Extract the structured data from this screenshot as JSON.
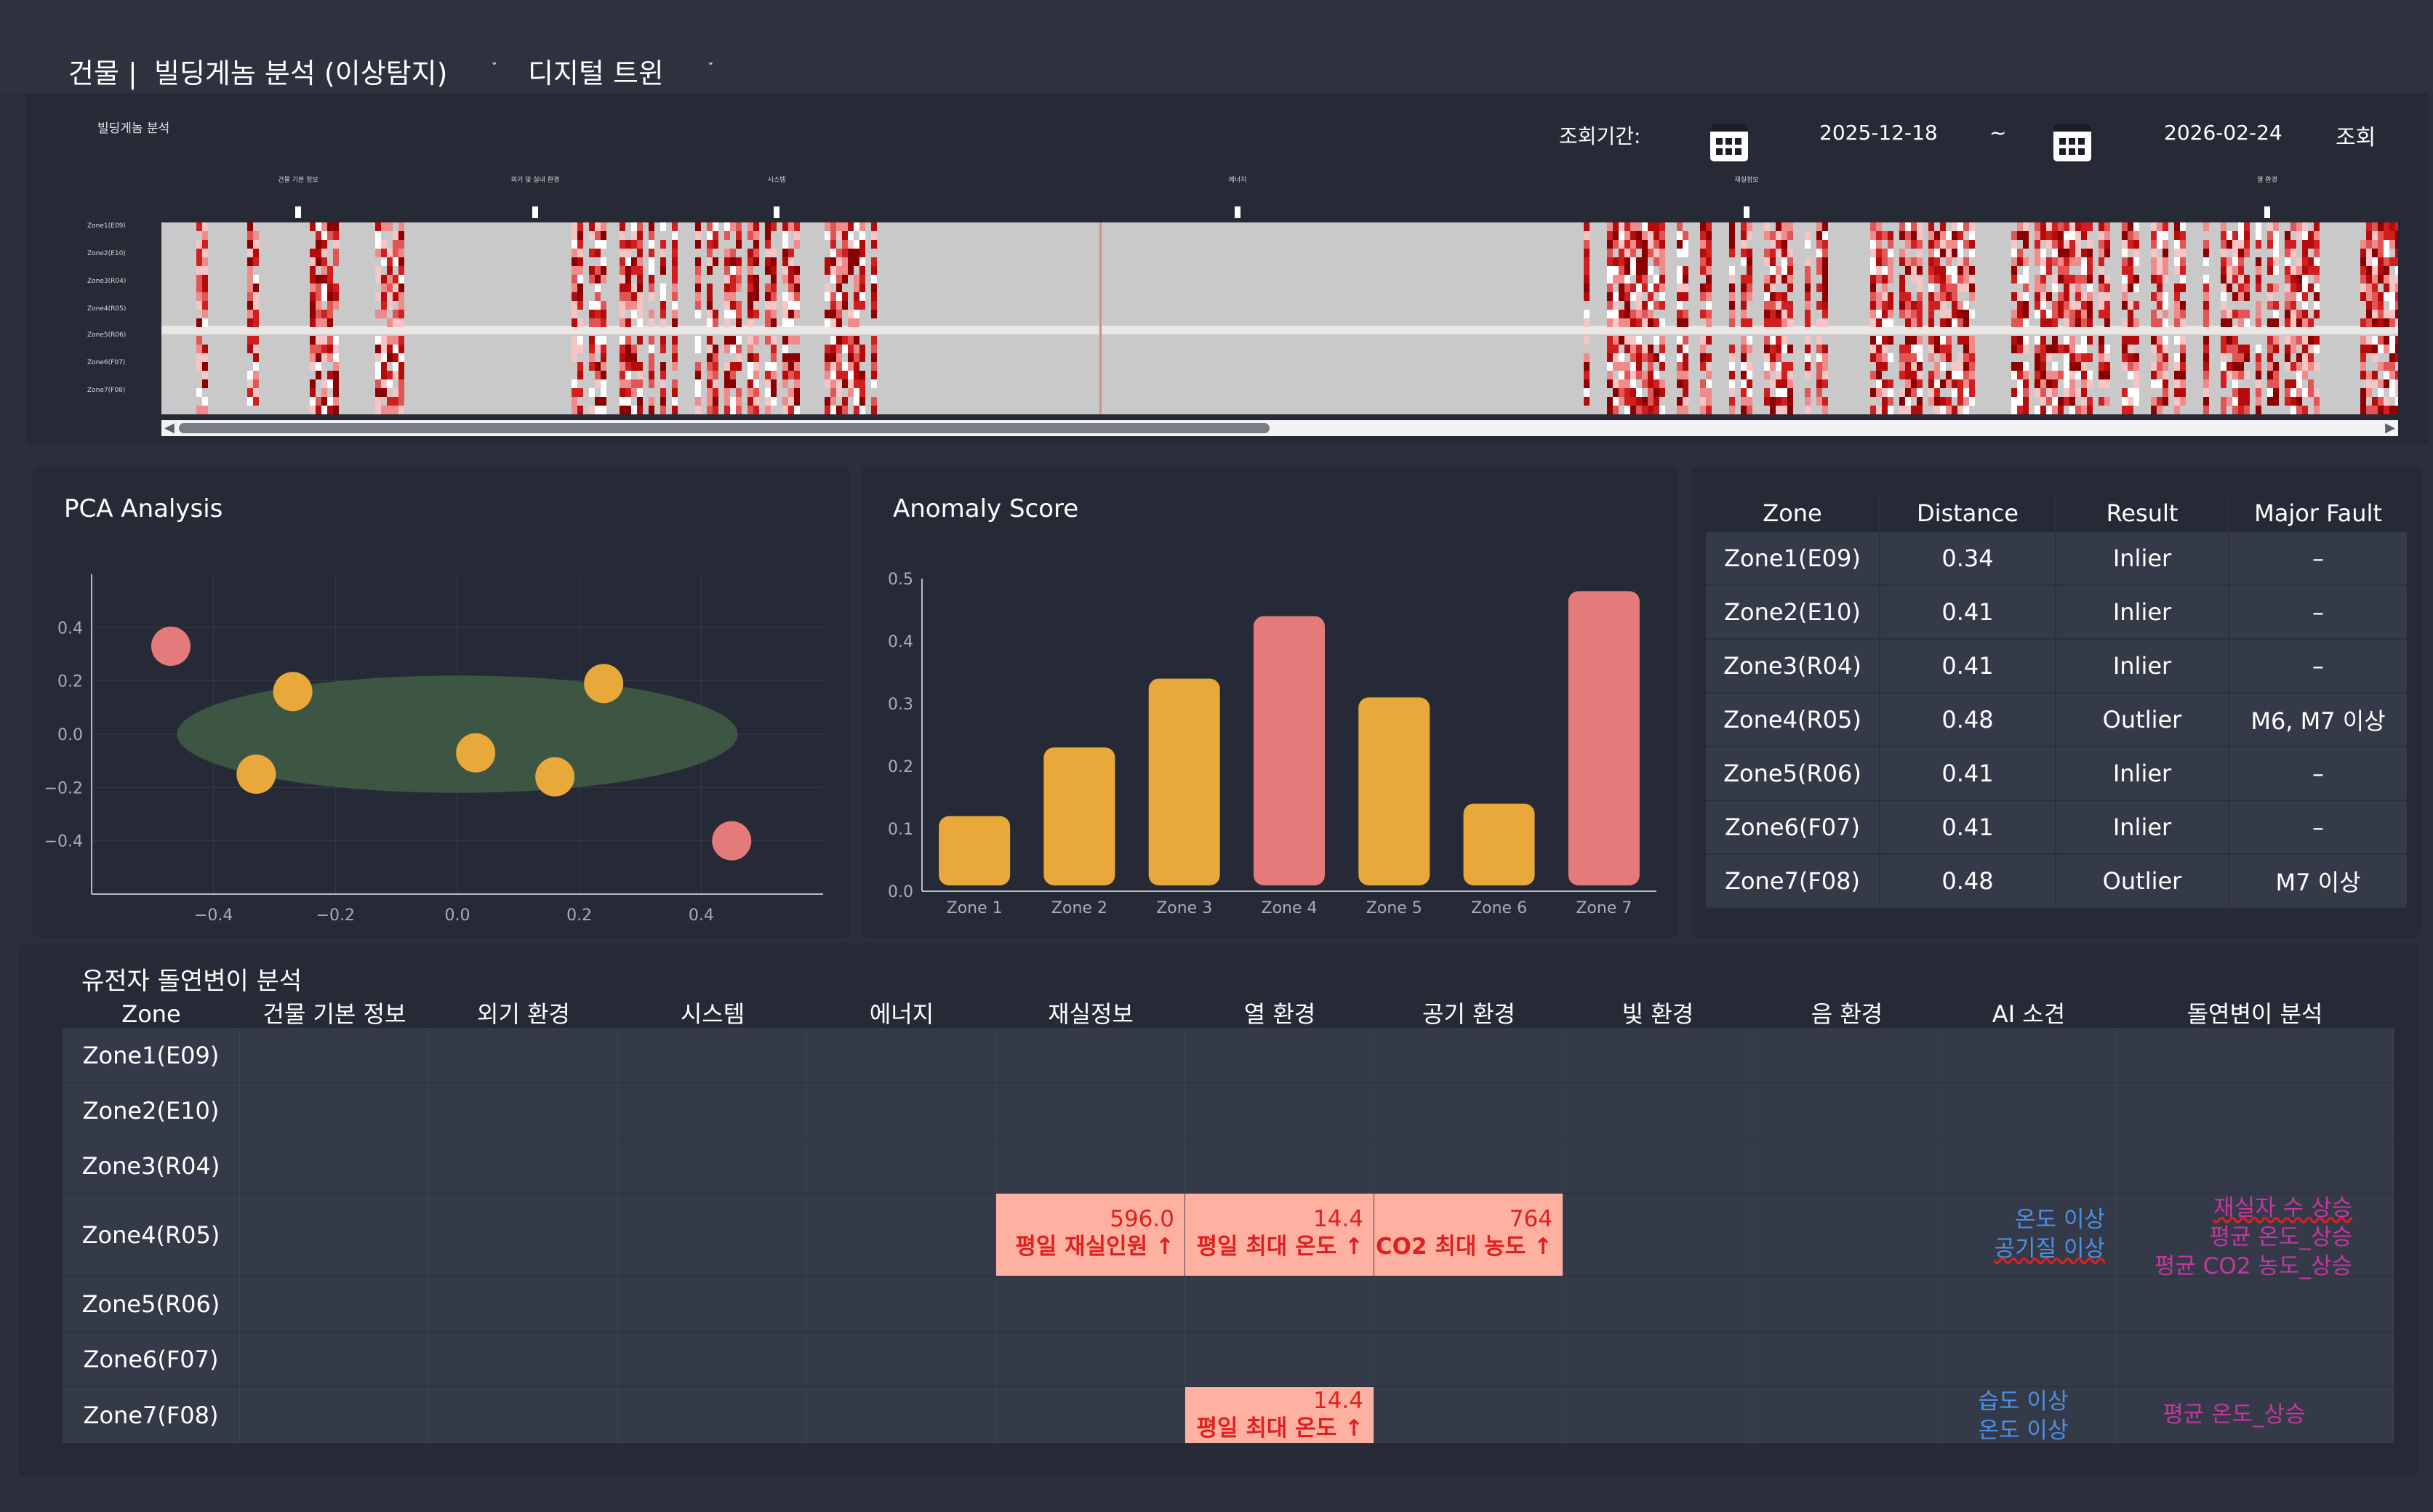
{
  "header": {
    "crumb1": "건물 |",
    "crumb2": "빌딩게놈 분석 (이상탐지)",
    "crumb3": "디지털 트윈"
  },
  "timeline": {
    "title": "빌딩게놈 분석",
    "period_label": "조회기간:",
    "start_date": "2025-12-18",
    "tilde": "~",
    "end_date": "2026-02-24",
    "query_button": "조회",
    "sections": [
      "건물 기본 정보",
      "외기 및 실내 환경",
      "시스템",
      "에너지",
      "재실정보",
      "열 환경"
    ],
    "zones": [
      "Zone1(E09)",
      "Zone2(E10)",
      "Zone3(R04)",
      "Zone4(R05)",
      "Zone5(R06)",
      "Zone6(F07)",
      "Zone7(F08)"
    ]
  },
  "pca": {
    "title": "PCA Analysis",
    "x_ticks": [
      "−0.4",
      "−0.2",
      "0.0",
      "0.2",
      "0.4"
    ],
    "y_ticks": [
      "0.4",
      "0.2",
      "0.0",
      "−0.2",
      "−0.4"
    ],
    "inlier_color": "#e8a93a",
    "outlier_color": "#e47a7a",
    "ellipse_color": "#3f5b45"
  },
  "anomaly": {
    "title": "Anomaly Score"
  },
  "chart_data": [
    {
      "type": "scatter",
      "title": "PCA Analysis",
      "xlim": [
        -0.6,
        0.6
      ],
      "ylim": [
        -0.6,
        0.6
      ],
      "ellipse": {
        "center": [
          0.0,
          0.0
        ],
        "rx": 0.46,
        "ry": 0.22
      },
      "points": [
        {
          "x": -0.47,
          "y": 0.33,
          "outlier": true
        },
        {
          "x": -0.27,
          "y": 0.16,
          "outlier": false
        },
        {
          "x": -0.33,
          "y": -0.15,
          "outlier": false
        },
        {
          "x": 0.03,
          "y": -0.07,
          "outlier": false
        },
        {
          "x": 0.16,
          "y": -0.16,
          "outlier": false
        },
        {
          "x": 0.24,
          "y": 0.19,
          "outlier": false
        },
        {
          "x": 0.45,
          "y": -0.4,
          "outlier": true
        }
      ]
    },
    {
      "type": "bar",
      "title": "Anomaly Score",
      "categories": [
        "Zone 1",
        "Zone 2",
        "Zone 3",
        "Zone 4",
        "Zone 5",
        "Zone 6",
        "Zone 7"
      ],
      "values": [
        0.12,
        0.23,
        0.34,
        0.44,
        0.31,
        0.14,
        0.48
      ],
      "outlier": [
        false,
        false,
        false,
        true,
        false,
        false,
        true
      ],
      "y_ticks": [
        "0.0",
        "0.1",
        "0.2",
        "0.3",
        "0.4",
        "0.5"
      ],
      "ylim": [
        0,
        0.5
      ]
    }
  ],
  "zone_table": {
    "headers": [
      "Zone",
      "Distance",
      "Result",
      "Major Fault"
    ],
    "rows": [
      [
        "Zone1(E09)",
        "0.34",
        "Inlier",
        "–"
      ],
      [
        "Zone2(E10)",
        "0.41",
        "Inlier",
        "–"
      ],
      [
        "Zone3(R04)",
        "0.41",
        "Inlier",
        "–"
      ],
      [
        "Zone4(R05)",
        "0.48",
        "Outlier",
        "M6, M7 이상"
      ],
      [
        "Zone5(R06)",
        "0.41",
        "Inlier",
        "–"
      ],
      [
        "Zone6(F07)",
        "0.41",
        "Inlier",
        "–"
      ],
      [
        "Zone7(F08)",
        "0.48",
        "Outlier",
        "M7 이상"
      ]
    ]
  },
  "genetic": {
    "title": "유전자 돌연변이 분석",
    "headers": [
      "Zone",
      "건물 기본 정보",
      "외기 환경",
      "시스템",
      "에너지",
      "재실정보",
      "열 환경",
      "공기 환경",
      "빛 환경",
      "음 환경",
      "AI 소견",
      "돌연변이 분석"
    ],
    "zones": [
      "Zone1(E09)",
      "Zone2(E10)",
      "Zone3(R04)",
      "Zone4(R05)",
      "Zone5(R06)",
      "Zone6(F07)",
      "Zone7(F08)"
    ],
    "zone4": {
      "occ_value": "596.0",
      "occ_label": "평일 재실인원 ↑",
      "heat_value": "14.4",
      "heat_label": "평일 최대 온도 ↑",
      "air_value": "764",
      "air_label": "CO2 최대 농도 ↑",
      "ai1": "온도 이상",
      "ai2": "공기질 이상",
      "m1": "재실자 수 상승",
      "m2": "평균 온도_상승",
      "m3": "평균 CO2 농도_상승"
    },
    "zone7": {
      "heat_value": "14.4",
      "heat_label": "평일 최대 온도 ↑",
      "ai1": "습도 이상",
      "ai2": "온도 이상",
      "m1": "평균 온도_상승"
    }
  }
}
